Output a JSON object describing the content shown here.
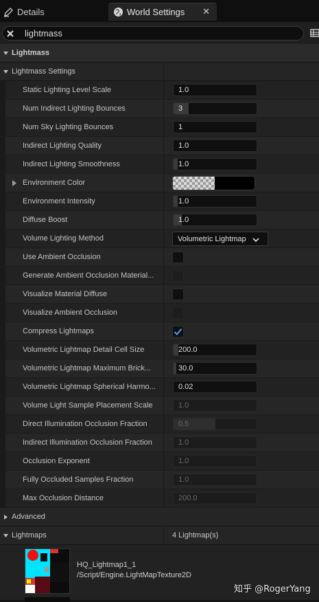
{
  "tabs": [
    {
      "label": "Details",
      "icon": "pencil-icon",
      "active": false
    },
    {
      "label": "World Settings",
      "icon": "globe-icon",
      "active": true
    }
  ],
  "search": {
    "value": "lightmass"
  },
  "sections": {
    "lightmass": "Lightmass",
    "lightmass_settings": "Lightmass Settings",
    "advanced": "Advanced",
    "lightmaps": "Lightmaps",
    "lightmaps_count": "4 Lightmap(s)"
  },
  "properties": [
    {
      "label": "Static Lighting Level Scale",
      "type": "number",
      "value": "1.0"
    },
    {
      "label": "Num Indirect Lighting Bounces",
      "type": "number",
      "value": "3",
      "fill": 0.18
    },
    {
      "label": "Num Sky Lighting Bounces",
      "type": "number",
      "value": "1"
    },
    {
      "label": "Indirect Lighting Quality",
      "type": "number",
      "value": "1.0"
    },
    {
      "label": "Indirect Lighting Smoothness",
      "type": "number",
      "value": "1.0",
      "fill": 0.05
    },
    {
      "label": "Environment Color",
      "type": "color",
      "color": "#000000"
    },
    {
      "label": "Environment Intensity",
      "type": "number",
      "value": "1.0",
      "fill": 0.05
    },
    {
      "label": "Diffuse Boost",
      "type": "number",
      "value": "1.0",
      "fill": 0.1
    },
    {
      "label": "Volume Lighting Method",
      "type": "dropdown",
      "value": "Volumetric Lightmap"
    },
    {
      "label": "Use Ambient Occlusion",
      "type": "checkbox",
      "checked": false
    },
    {
      "label": "Generate Ambient Occlusion Material...",
      "type": "checkbox",
      "checked": false,
      "disabled": true
    },
    {
      "label": "Visualize Material Diffuse",
      "type": "checkbox",
      "checked": false
    },
    {
      "label": "Visualize Ambient Occlusion",
      "type": "checkbox",
      "checked": false,
      "disabled": true
    },
    {
      "label": "Compress Lightmaps",
      "type": "checkbox",
      "checked": true
    },
    {
      "label": "Volumetric Lightmap Detail Cell Size",
      "type": "number",
      "value": "200.0",
      "fill": 0.06
    },
    {
      "label": "Volumetric Lightmap Maximum Brick...",
      "type": "number",
      "value": "30.0",
      "fill": 0.03
    },
    {
      "label": "Volumetric Lightmap Spherical Harmo...",
      "type": "number",
      "value": "0.02"
    },
    {
      "label": "Volume Light Sample Placement Scale",
      "type": "number",
      "value": "1.0",
      "disabled": true
    },
    {
      "label": "Direct Illumination Occlusion Fraction",
      "type": "number",
      "value": "0.5",
      "fill": 0.5,
      "disabled": true
    },
    {
      "label": "Indirect Illumination Occlusion Fraction",
      "type": "number",
      "value": "1.0",
      "disabled": true
    },
    {
      "label": "Occlusion Exponent",
      "type": "number",
      "value": "1.0",
      "disabled": true
    },
    {
      "label": "Fully Occluded Samples Fraction",
      "type": "number",
      "value": "1.0",
      "disabled": true
    },
    {
      "label": "Max Occlusion Distance",
      "type": "number",
      "value": "200.0",
      "disabled": true
    }
  ],
  "lightmap": {
    "name": "HQ_Lightmap1_1",
    "path": "/Script/Engine.LightMapTexture2D"
  },
  "watermark": "知乎 @RogerYang",
  "colors": {
    "accent_check": "#4a9cff",
    "panel_bg": "#222222"
  }
}
